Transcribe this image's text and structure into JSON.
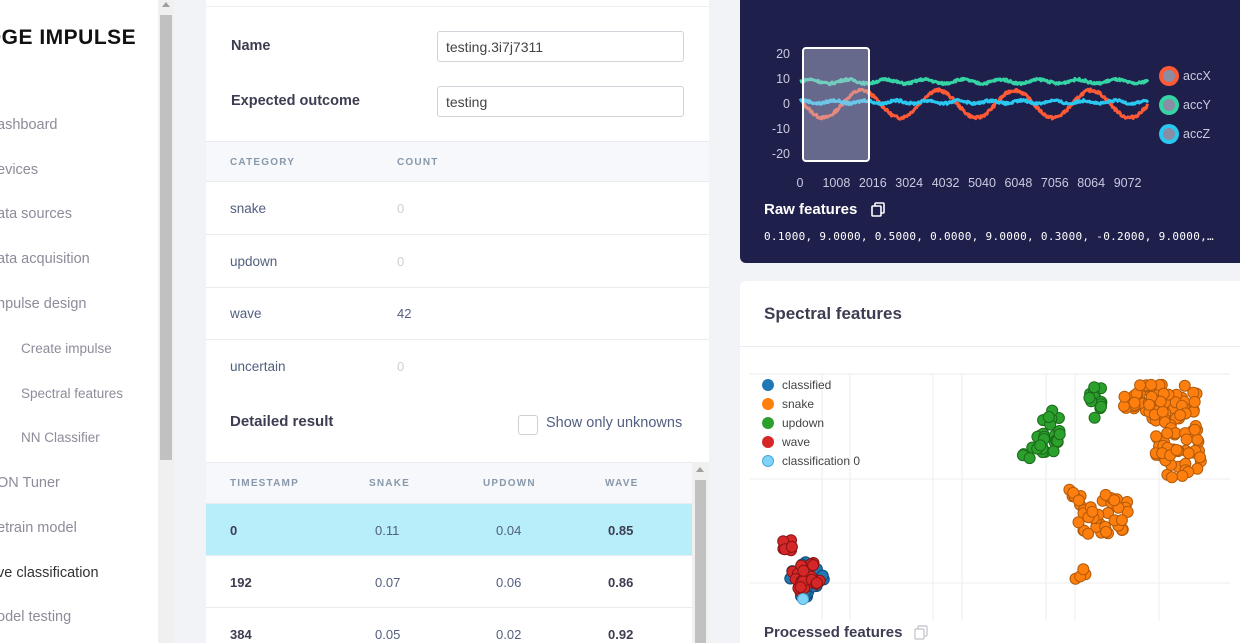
{
  "brand": "DGE IMPULSE",
  "sidebar": {
    "items": [
      {
        "label": "ashboard"
      },
      {
        "label": "evices"
      },
      {
        "label": "ata sources"
      },
      {
        "label": "ata acquisition"
      },
      {
        "label": "npulse design"
      },
      {
        "label": "Create impulse"
      },
      {
        "label": "Spectral features"
      },
      {
        "label": "NN Classifier"
      },
      {
        "label": "ON Tuner"
      },
      {
        "label": "etrain model"
      },
      {
        "label": "ve classification"
      },
      {
        "label": "odel testing"
      }
    ]
  },
  "form": {
    "name_label": "Name",
    "name_value": "testing.3i7j7311",
    "outcome_label": "Expected outcome",
    "outcome_value": "testing"
  },
  "category_table": {
    "headers": [
      "CATEGORY",
      "COUNT"
    ],
    "rows": [
      {
        "category": "snake",
        "count": "0"
      },
      {
        "category": "updown",
        "count": "0"
      },
      {
        "category": "wave",
        "count": "42"
      },
      {
        "category": "uncertain",
        "count": "0"
      }
    ]
  },
  "detailed": {
    "title": "Detailed result",
    "checkbox_label": "Show only unknowns",
    "headers": [
      "TIMESTAMP",
      "SNAKE",
      "UPDOWN",
      "WAVE"
    ],
    "rows": [
      {
        "timestamp": "0",
        "snake": "0.11",
        "updown": "0.04",
        "wave": "0.85"
      },
      {
        "timestamp": "192",
        "snake": "0.07",
        "updown": "0.06",
        "wave": "0.86"
      },
      {
        "timestamp": "384",
        "snake": "0.05",
        "updown": "0.02",
        "wave": "0.92"
      }
    ]
  },
  "raw": {
    "title": "Raw features",
    "values": "0.1000, 9.0000, 0.5000, 0.0000, 9.0000, 0.3000, -0.2000, 9.0000, 0.…"
  },
  "spectral": {
    "title": "Spectral features",
    "legend": [
      {
        "label": "classified",
        "color": "#1f77b4"
      },
      {
        "label": "snake",
        "color": "#ff7f0e"
      },
      {
        "label": "updown",
        "color": "#2ca02c"
      },
      {
        "label": "wave",
        "color": "#d62728"
      },
      {
        "label": "classification 0",
        "color": "#7fd3f7"
      }
    ],
    "processed_title": "Processed features"
  },
  "chart_data": {
    "type": "line",
    "x_ticks": [
      "0",
      "1008",
      "2016",
      "3024",
      "4032",
      "5040",
      "6048",
      "7056",
      "8064",
      "9072"
    ],
    "y_ticks": [
      "20",
      "10",
      "0",
      "-10",
      "-20"
    ],
    "ylim": [
      -20,
      20
    ],
    "xlim": [
      0,
      10000
    ],
    "series": [
      {
        "name": "accX",
        "color": "#ff5a36",
        "kind": "sine",
        "amplitude": 5.5,
        "period": 2200,
        "offset": 0,
        "phase": 2.8
      },
      {
        "name": "accY",
        "color": "#35d4a5",
        "kind": "flat",
        "amplitude": 0.8,
        "period": 1100,
        "offset": 9,
        "phase": 0
      },
      {
        "name": "accZ",
        "color": "#2ac8f0",
        "kind": "flat",
        "amplitude": 0.6,
        "period": 900,
        "offset": 0.8,
        "phase": 1
      }
    ],
    "window": [
      0,
      2000
    ]
  }
}
